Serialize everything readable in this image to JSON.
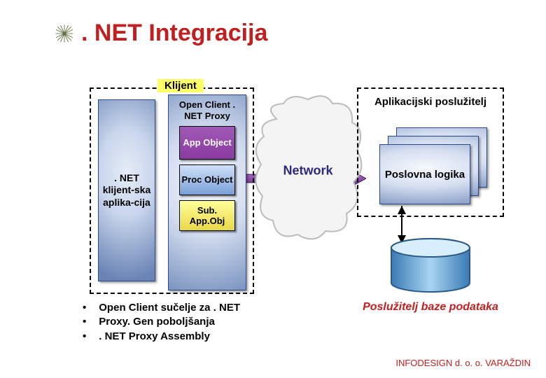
{
  "title": ". NET Integracija",
  "klijent": {
    "label": "Klijent",
    "client_app": ". NET klijent-ska aplika-cija",
    "proxy_title": "Open Client . NET Proxy",
    "boxes": {
      "app_object": "App Object",
      "proc_object": "Proc Object",
      "sub_app_obj": "Sub. App.Obj"
    }
  },
  "network_label": "Network",
  "server": {
    "title": "Aplikacijski poslužitelj",
    "card_label": "Poslovna logika"
  },
  "db_label": "Poslužitelj baze podataka",
  "bullets": [
    "Open Client sučelje za . NET",
    "Proxy. Gen poboljšanja",
    ". NET Proxy Assembly"
  ],
  "footer": "INFODESIGN d. o. o. VARAŽDIN"
}
